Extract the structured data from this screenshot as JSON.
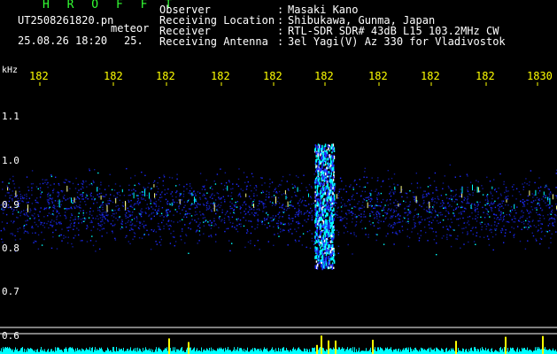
{
  "header": {
    "title": "H R O F F T",
    "file_name": "UT2508261820.pn",
    "tag": "meteor",
    "datetime": "25.08.26 18:20",
    "count": "25.",
    "info": [
      {
        "label": "Observer",
        "value": "Masaki Kano"
      },
      {
        "label": "Receiving Location",
        "value": "Shibukawa, Gunma, Japan"
      },
      {
        "label": "Receiver",
        "value": "RTL-SDR SDR# 43dB L15 103.2MHz CW"
      },
      {
        "label": "Receiving Antenna",
        "value": "3el Yagi(V) Az 330 for Vladivostok"
      }
    ]
  },
  "axis": {
    "unit_label": "kHz",
    "x_ticks": [
      "182",
      "182",
      "182",
      "182",
      "182",
      "182",
      "182",
      "182",
      "182",
      "1830"
    ],
    "y_ticks": [
      "1.1",
      "1.0",
      "0.9",
      "0.8",
      "0.7",
      "0.6"
    ]
  },
  "colors": {
    "background": "#000000",
    "header_green": "#33ff33",
    "tick_yellow": "#ffff00",
    "signal_cyan": "#00ffff",
    "signal_blue": "#1e2bff"
  }
}
